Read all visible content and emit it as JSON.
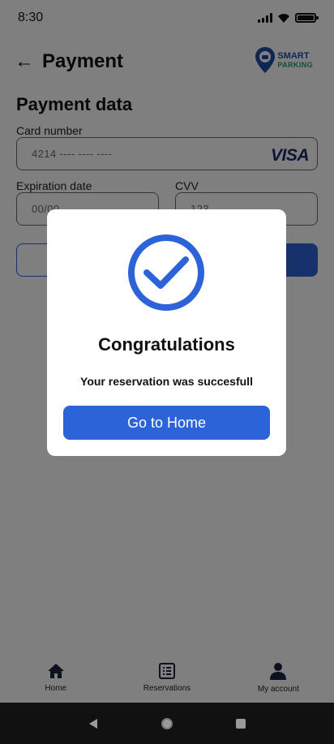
{
  "status_bar": {
    "time": "8:30"
  },
  "header": {
    "title": "Payment",
    "brand": {
      "line1": "SMART",
      "line2": "PARKING"
    }
  },
  "form": {
    "section_title": "Payment data",
    "card_number": {
      "label": "Card number",
      "placeholder": "4214 ---- ---- ----",
      "card_brand": "VISA"
    },
    "expiration": {
      "label": "Expiration date",
      "placeholder": "00/00"
    },
    "cvv": {
      "label": "CVV",
      "placeholder": "123"
    }
  },
  "dialog": {
    "title": "Congratulations",
    "message": "Your reservation was succesfull",
    "button_label": "Go to Home"
  },
  "bottom_nav": [
    {
      "label": "Home",
      "icon": "home-icon"
    },
    {
      "label": "Reservations",
      "icon": "list-icon"
    },
    {
      "label": "My account",
      "icon": "person-icon"
    }
  ],
  "colors": {
    "primary": "#2d63d8",
    "brand_blue": "#1d4fa5",
    "brand_green": "#19a36e",
    "overlay": "rgba(0,0,0,0.5)"
  }
}
